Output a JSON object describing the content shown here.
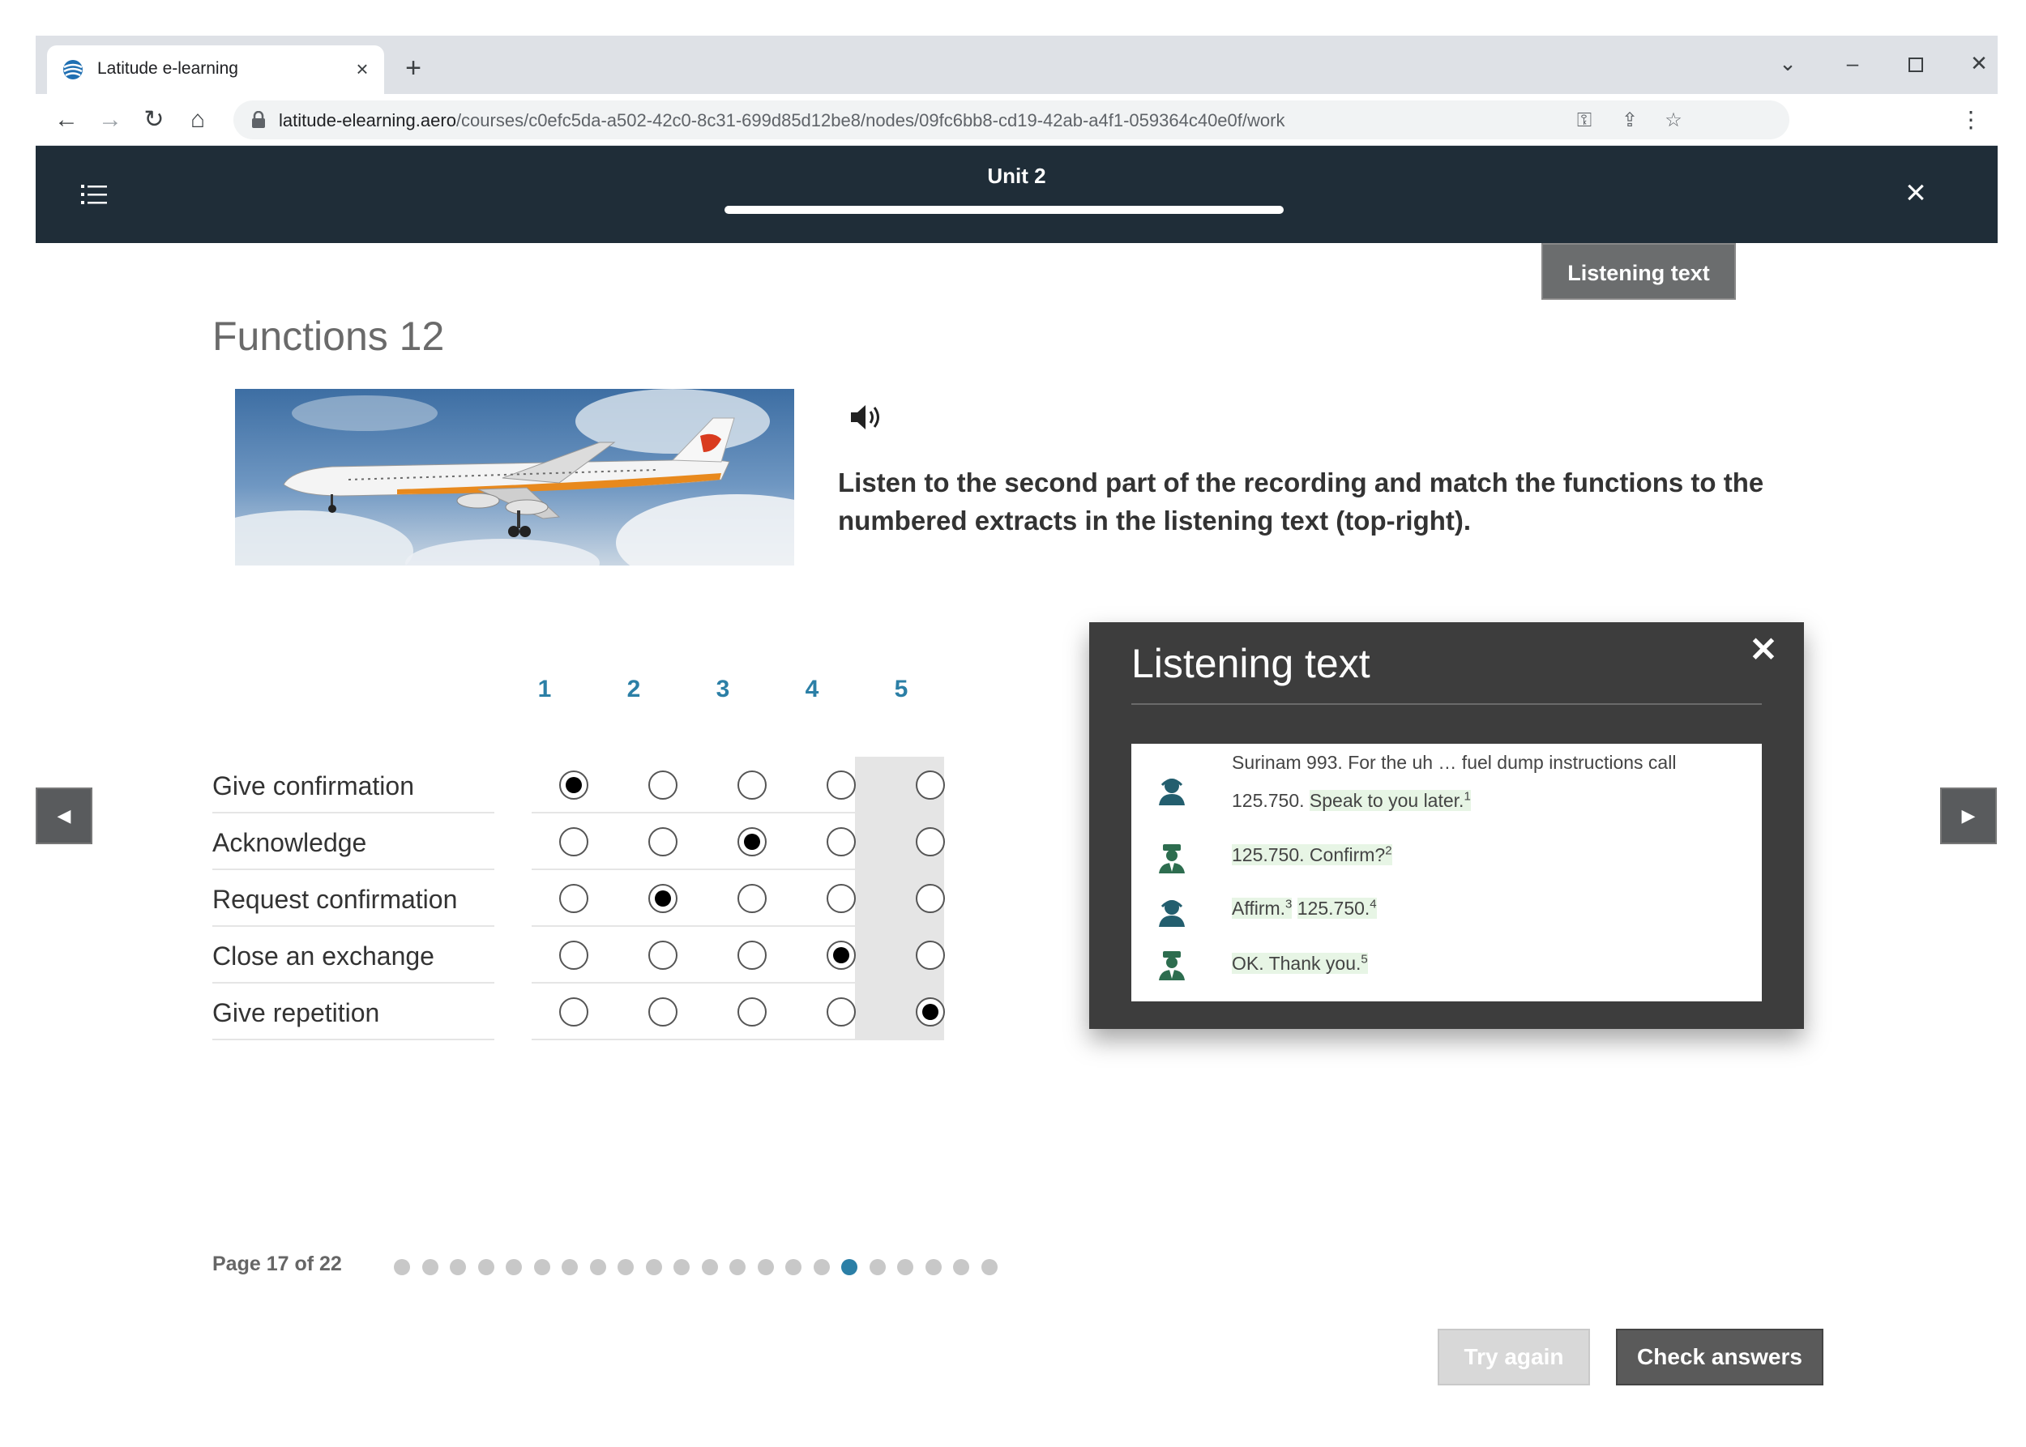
{
  "browser": {
    "tab_title": "Latitude e-learning",
    "url_host": "latitude-elearning.aero",
    "url_path": "/courses/c0efc5da-a502-42c0-8c31-699d85d12be8/nodes/09fc6bb8-cd19-42ab-a4f1-059364c40e0f/work"
  },
  "header": {
    "unit_title": "Unit 2"
  },
  "listening_tab_label": "Listening text",
  "page": {
    "title": "Functions 12",
    "instruction": "Listen to the second part of the recording and match the functions to the numbered extracts in the listening text (top-right)."
  },
  "matrix": {
    "columns": [
      "1",
      "2",
      "3",
      "4",
      "5"
    ],
    "rows": [
      {
        "label": "Give confirmation",
        "selected": 1
      },
      {
        "label": "Acknowledge",
        "selected": 3
      },
      {
        "label": "Request confirmation",
        "selected": 2
      },
      {
        "label": "Close an exchange",
        "selected": 4
      },
      {
        "label": "Give repetition",
        "selected": 5
      }
    ]
  },
  "listening_panel": {
    "title": "Listening text",
    "lines": {
      "l1a": "Surinam 993. For the uh … fuel dump instructions call",
      "l1b": "125.750.",
      "l1c": "Speak to you later.",
      "l1n": "1",
      "l2a": "125.750. Confirm?",
      "l2n": "2",
      "l3a": "Affirm.",
      "l3n": "3",
      "l3b": "125.750.",
      "l3m": "4",
      "l4a": "OK. Thank you.",
      "l4n": "5"
    },
    "speakers": [
      "controller-icon",
      "pilot-icon",
      "controller-icon",
      "pilot-icon"
    ]
  },
  "pagination": {
    "label": "Page 17 of 22",
    "total": 22,
    "current": 17
  },
  "buttons": {
    "try_again": "Try again",
    "check_answers": "Check answers"
  },
  "colors": {
    "header_bg": "#1f2d38",
    "accent": "#2b7fa6",
    "panel_bg": "#3d3d3d",
    "highlight": "#e7f5e5"
  }
}
